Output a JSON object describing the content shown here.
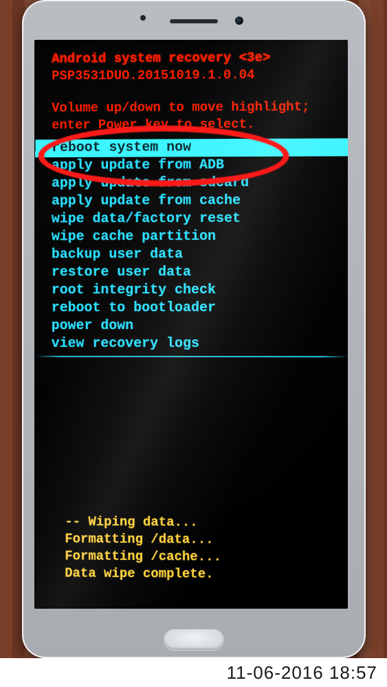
{
  "header": {
    "title": "Android system recovery <3e>",
    "build": "PSP3531DUO.20151019.1.0.04"
  },
  "instructions": {
    "line1": "Volume up/down to move highlight;",
    "line2": "enter Power key to select."
  },
  "menu": {
    "items": [
      "reboot system now",
      "apply update from ADB",
      "apply update from sdcard",
      "apply update from cache",
      "wipe data/factory reset",
      "wipe cache partition",
      "backup user data",
      "restore user data",
      "root integrity check",
      "reboot to bootloader",
      "power down",
      "view recovery logs"
    ],
    "selected_index": 0
  },
  "log": {
    "lines": [
      "-- Wiping data...",
      "Formatting /data...",
      "Formatting /cache...",
      "Data wipe complete."
    ]
  },
  "photo_timestamp": "11-06-2016 18:57",
  "annotation": {
    "type": "ellipse",
    "color": "#ff1a1a"
  }
}
